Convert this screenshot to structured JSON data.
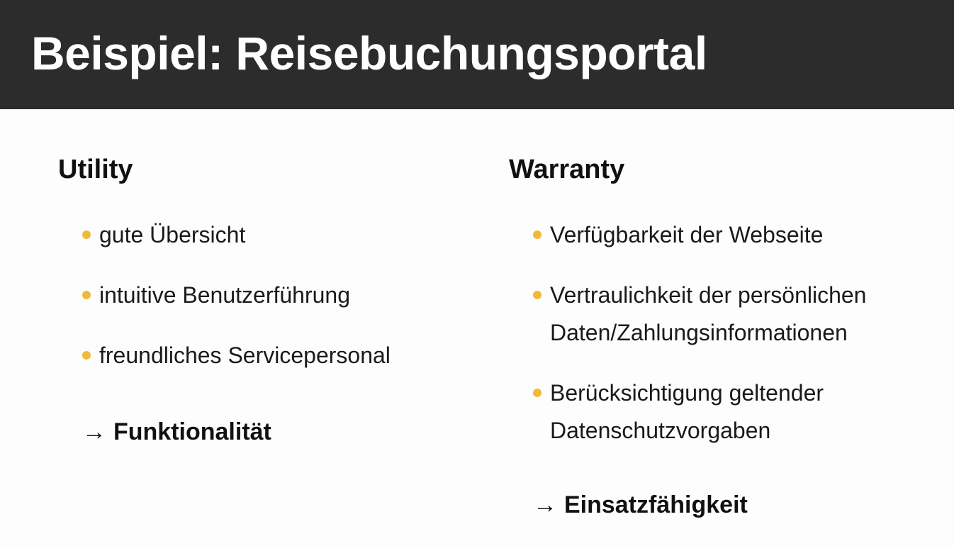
{
  "slide": {
    "title": "Beispiel: Reisebuchungsportal"
  },
  "utility": {
    "heading": "Utility",
    "items": [
      {
        "text": "gute Übersicht"
      },
      {
        "text": "intuitive Benutzerführung"
      },
      {
        "text": "freundliches Servicepersonal"
      }
    ],
    "conclusion_arrow": "→",
    "conclusion": "Funktionalität"
  },
  "warranty": {
    "heading": "Warranty",
    "items": [
      {
        "line1": "Verfügbarkeit der Webseite"
      },
      {
        "line1": "Vertraulichkeit der persönlichen",
        "line2": "Daten/Zahlungsinformationen"
      },
      {
        "line1": "Berücksichtigung geltender",
        "line2": "Datenschutzvorgaben"
      }
    ],
    "conclusion_arrow": "→",
    "conclusion": "Einsatzfähigkeit"
  },
  "colors": {
    "header_bg": "#2c2c2c",
    "bullet": "#f0b93a",
    "background": "#fdfdfd"
  }
}
